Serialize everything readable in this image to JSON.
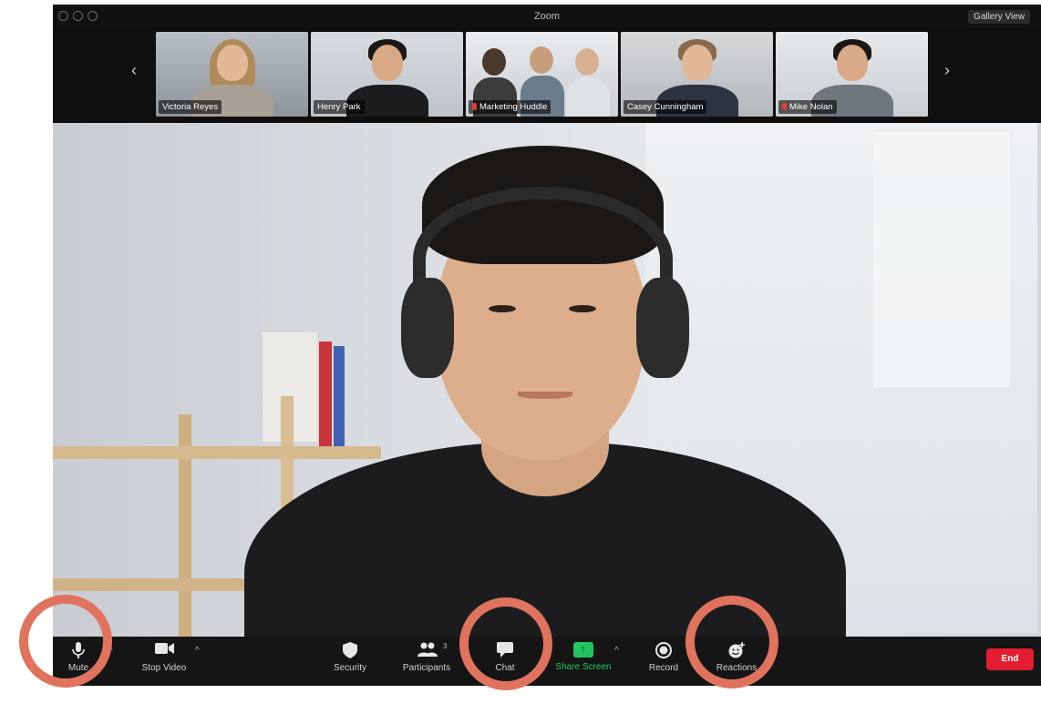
{
  "window": {
    "title": "Zoom",
    "view_button": "Gallery View"
  },
  "thumbnails": [
    {
      "name": "Victoria Reyes",
      "muted": false
    },
    {
      "name": "Henry Park",
      "muted": false,
      "active": true
    },
    {
      "name": "Marketing Huddle",
      "muted": true
    },
    {
      "name": "Casey Cunningham",
      "muted": false
    },
    {
      "name": "Mike Nolan",
      "muted": true
    }
  ],
  "toolbar": {
    "mute": "Mute",
    "video": "Stop Video",
    "security": "Security",
    "participants": "Participants",
    "participants_count": "3",
    "chat": "Chat",
    "share": "Share Screen",
    "record": "Record",
    "reactions": "Reactions",
    "end": "End"
  },
  "colors": {
    "accent_green": "#22c55e",
    "end_red": "#e11d2f",
    "annotation": "#e0735e"
  }
}
